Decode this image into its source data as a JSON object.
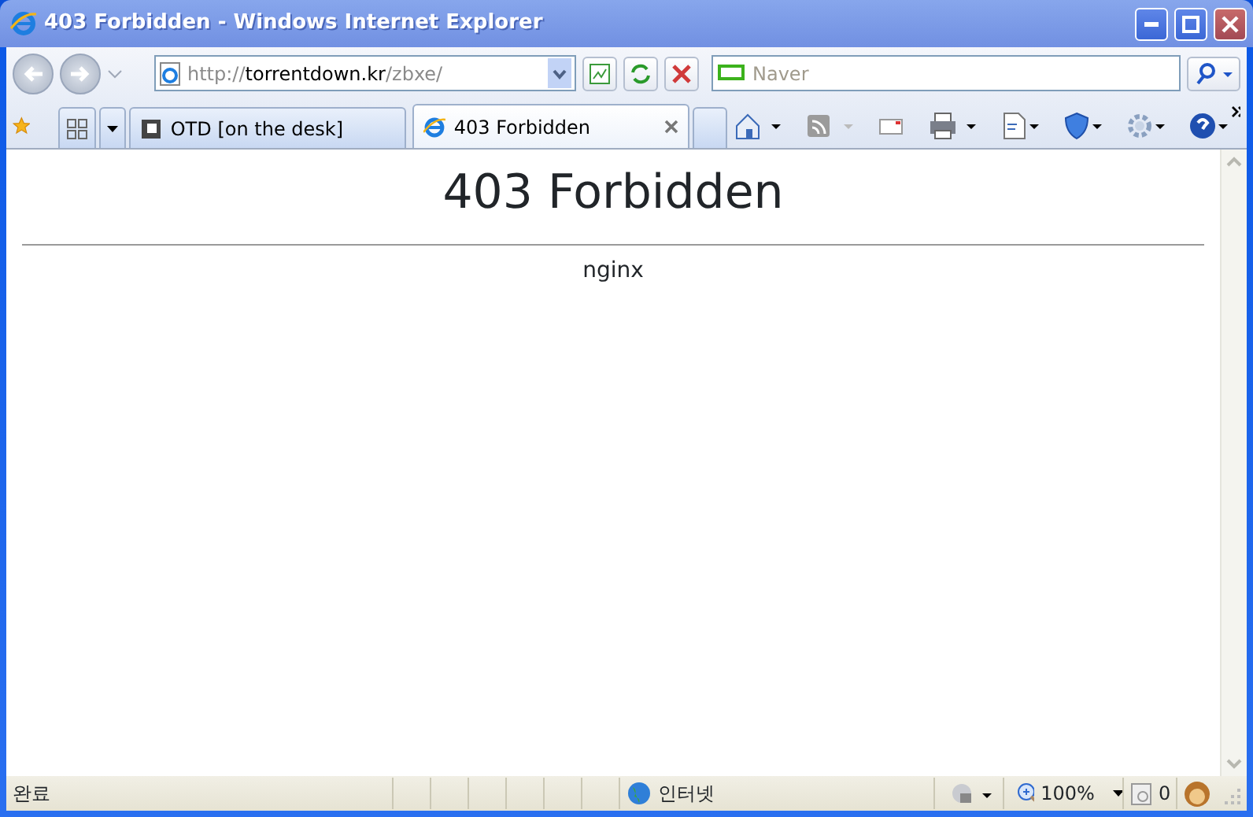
{
  "window": {
    "title": "403 Forbidden - Windows Internet Explorer"
  },
  "address_bar": {
    "url_parts": [
      {
        "kind": "scheme",
        "text": "http://"
      },
      {
        "kind": "host",
        "text": "torrentdown.kr"
      },
      {
        "kind": "path",
        "text": "/zbxe/"
      }
    ]
  },
  "search_box": {
    "placeholder": "Naver"
  },
  "tabs": [
    {
      "label": "OTD [on the desk]",
      "selected": false
    },
    {
      "label": "403 Forbidden",
      "selected": true
    }
  ],
  "page": {
    "heading": "403 Forbidden",
    "server": "nginx"
  },
  "status_bar": {
    "status": "완료",
    "zone": "인터넷",
    "zoom": "100%",
    "blocked_count": "0"
  }
}
